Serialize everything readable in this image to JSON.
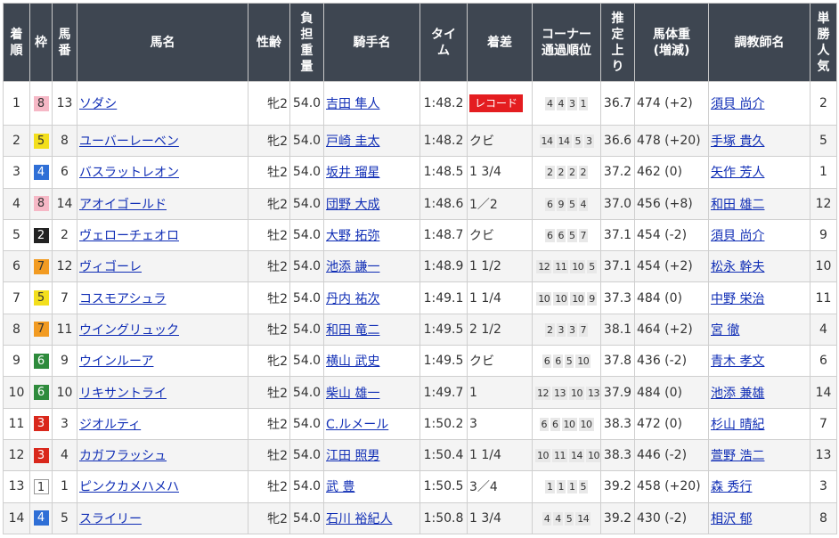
{
  "headers": {
    "chakujun": [
      "着",
      "順"
    ],
    "waku": "枠",
    "umaban": [
      "馬",
      "番"
    ],
    "horse": "馬名",
    "seirei": "性齢",
    "kinryo": [
      "負",
      "担",
      "重",
      "量"
    ],
    "jockey": "騎手名",
    "time": [
      "タイ",
      "ム"
    ],
    "margin": "着差",
    "corner": [
      "コーナー",
      "通過順位"
    ],
    "agari": [
      "推",
      "定",
      "上",
      "り"
    ],
    "weight": [
      "馬体重",
      "(増減)"
    ],
    "trainer": "調教師名",
    "ninki": [
      "単",
      "勝",
      "人",
      "気"
    ]
  },
  "rows": [
    {
      "pos": "1",
      "waku": "8",
      "num": "13",
      "horse": "ソダシ",
      "sex": "牝2",
      "load": "54.0",
      "jockey": "吉田 隼人",
      "time": "1:48.2",
      "margin": "",
      "record": "レコード",
      "corner": [
        "4",
        "4",
        "3",
        "1"
      ],
      "agari": "36.7",
      "weight": "474 (+2)",
      "trainer": "須貝 尚介",
      "pop": "2"
    },
    {
      "pos": "2",
      "waku": "5",
      "num": "8",
      "horse": "ユーバーレーベン",
      "sex": "牝2",
      "load": "54.0",
      "jockey": "戸崎 圭太",
      "time": "1:48.2",
      "margin": "クビ",
      "record": "",
      "corner": [
        "14",
        "14",
        "5",
        "3"
      ],
      "agari": "36.6",
      "weight": "478 (+20)",
      "trainer": "手塚 貴久",
      "pop": "5"
    },
    {
      "pos": "3",
      "waku": "4",
      "num": "6",
      "horse": "バスラットレオン",
      "sex": "牡2",
      "load": "54.0",
      "jockey": "坂井 瑠星",
      "time": "1:48.5",
      "margin": "1 3/4",
      "record": "",
      "corner": [
        "2",
        "2",
        "2",
        "2"
      ],
      "agari": "37.2",
      "weight": "462 (0)",
      "trainer": "矢作 芳人",
      "pop": "1"
    },
    {
      "pos": "4",
      "waku": "8",
      "num": "14",
      "horse": "アオイゴールド",
      "sex": "牝2",
      "load": "54.0",
      "jockey": "団野 大成",
      "time": "1:48.6",
      "margin": "1／2",
      "record": "",
      "corner": [
        "6",
        "9",
        "5",
        "4"
      ],
      "agari": "37.0",
      "weight": "456 (+8)",
      "trainer": "和田 雄二",
      "pop": "12"
    },
    {
      "pos": "5",
      "waku": "2",
      "num": "2",
      "horse": "ヴェローチェオロ",
      "sex": "牡2",
      "load": "54.0",
      "jockey": "大野 拓弥",
      "time": "1:48.7",
      "margin": "クビ",
      "record": "",
      "corner": [
        "6",
        "6",
        "5",
        "7"
      ],
      "agari": "37.1",
      "weight": "454 (-2)",
      "trainer": "須貝 尚介",
      "pop": "9"
    },
    {
      "pos": "6",
      "waku": "7",
      "num": "12",
      "horse": "ヴィゴーレ",
      "sex": "牡2",
      "load": "54.0",
      "jockey": "池添 謙一",
      "time": "1:48.9",
      "margin": "1 1/2",
      "record": "",
      "corner": [
        "12",
        "11",
        "10",
        "5"
      ],
      "agari": "37.1",
      "weight": "454 (+2)",
      "trainer": "松永 幹夫",
      "pop": "10"
    },
    {
      "pos": "7",
      "waku": "5",
      "num": "7",
      "horse": "コスモアシュラ",
      "sex": "牡2",
      "load": "54.0",
      "jockey": "丹内 祐次",
      "time": "1:49.1",
      "margin": "1 1/4",
      "record": "",
      "corner": [
        "10",
        "10",
        "10",
        "9"
      ],
      "agari": "37.3",
      "weight": "484 (0)",
      "trainer": "中野 栄治",
      "pop": "11"
    },
    {
      "pos": "8",
      "waku": "7",
      "num": "11",
      "horse": "ウイングリュック",
      "sex": "牡2",
      "load": "54.0",
      "jockey": "和田 竜二",
      "time": "1:49.5",
      "margin": "2 1/2",
      "record": "",
      "corner": [
        "2",
        "3",
        "3",
        "7"
      ],
      "agari": "38.1",
      "weight": "464 (+2)",
      "trainer": "宮 徹",
      "pop": "4"
    },
    {
      "pos": "9",
      "waku": "6",
      "num": "9",
      "horse": "ウインルーア",
      "sex": "牝2",
      "load": "54.0",
      "jockey": "横山 武史",
      "time": "1:49.5",
      "margin": "クビ",
      "record": "",
      "corner": [
        "6",
        "6",
        "5",
        "10"
      ],
      "agari": "37.8",
      "weight": "436 (-2)",
      "trainer": "青木 孝文",
      "pop": "6"
    },
    {
      "pos": "10",
      "waku": "6",
      "num": "10",
      "horse": "リキサントライ",
      "sex": "牡2",
      "load": "54.0",
      "jockey": "柴山 雄一",
      "time": "1:49.7",
      "margin": "1",
      "record": "",
      "corner": [
        "12",
        "13",
        "10",
        "13"
      ],
      "agari": "37.9",
      "weight": "484 (0)",
      "trainer": "池添 兼雄",
      "pop": "14"
    },
    {
      "pos": "11",
      "waku": "3",
      "num": "3",
      "horse": "ジオルティ",
      "sex": "牡2",
      "load": "54.0",
      "jockey": "C.ルメール",
      "time": "1:50.2",
      "margin": "3",
      "record": "",
      "corner": [
        "6",
        "6",
        "10",
        "10"
      ],
      "agari": "38.3",
      "weight": "472 (0)",
      "trainer": "杉山 晴紀",
      "pop": "7"
    },
    {
      "pos": "12",
      "waku": "3",
      "num": "4",
      "horse": "カガフラッシュ",
      "sex": "牡2",
      "load": "54.0",
      "jockey": "江田 照男",
      "time": "1:50.4",
      "margin": "1 1/4",
      "record": "",
      "corner": [
        "10",
        "11",
        "14",
        "10"
      ],
      "agari": "38.3",
      "weight": "446 (-2)",
      "trainer": "萱野 浩二",
      "pop": "13"
    },
    {
      "pos": "13",
      "waku": "1",
      "num": "1",
      "horse": "ピンクカメハメハ",
      "sex": "牡2",
      "load": "54.0",
      "jockey": "武 豊",
      "time": "1:50.5",
      "margin": "3／4",
      "record": "",
      "corner": [
        "1",
        "1",
        "1",
        "5"
      ],
      "agari": "39.2",
      "weight": "458 (+20)",
      "trainer": "森 秀行",
      "pop": "3"
    },
    {
      "pos": "14",
      "waku": "4",
      "num": "5",
      "horse": "スライリー",
      "sex": "牝2",
      "load": "54.0",
      "jockey": "石川 裕紀人",
      "time": "1:50.8",
      "margin": "1 3/4",
      "record": "",
      "corner": [
        "4",
        "4",
        "5",
        "14"
      ],
      "agari": "39.2",
      "weight": "430 (-2)",
      "trainer": "相沢 郁",
      "pop": "8"
    }
  ],
  "colors": {
    "header_bg": "#3e4651",
    "link": "#0f2db5",
    "record_bg": "#e41d20",
    "waku_1": "#ffffff",
    "waku_2": "#222222",
    "waku_3": "#d9281c",
    "waku_4": "#2f6fd6",
    "waku_5": "#f3df1d",
    "waku_6": "#2e8b3c",
    "waku_7": "#f29b22",
    "waku_8": "#f6b8c6"
  }
}
